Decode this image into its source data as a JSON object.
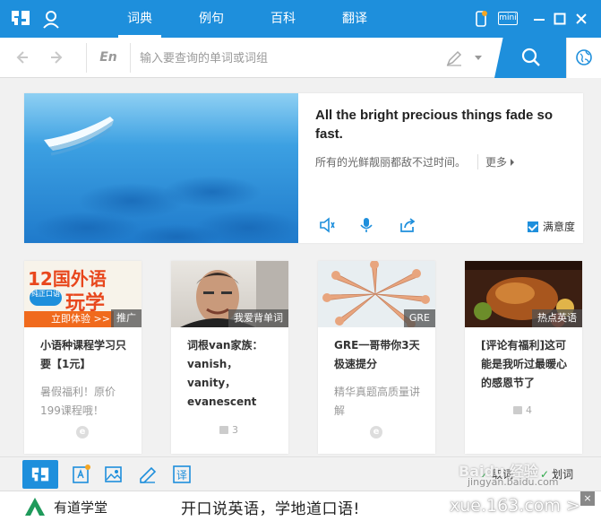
{
  "app": {
    "logo": "有",
    "tabs": [
      {
        "label": "词典",
        "active": true
      },
      {
        "label": "例句",
        "active": false
      },
      {
        "label": "百科",
        "active": false
      },
      {
        "label": "翻译",
        "active": false
      }
    ],
    "mini_label": "mini",
    "accent_color": "#1e8fdc"
  },
  "search": {
    "lang": "En",
    "placeholder": "输入要查询的单词或词组"
  },
  "hero": {
    "sentence": "All the bright precious things fade so fast.",
    "translation": "所有的光鲜靓丽都敌不过时间。",
    "more_label": "更多",
    "satisfaction_label": "满意度"
  },
  "cards": [
    {
      "tag": "推广",
      "title": "小语种课程学习只要【1元】",
      "desc": "暑假福利！原价199课程哦！",
      "image_text": [
        "12国外语",
        "纯正口语",
        "玩学",
        "立即体验 >>"
      ]
    },
    {
      "tag": "我爱背单词",
      "title": "词根van家族：vanish，vanity，evanescent",
      "likes": "3"
    },
    {
      "tag": "GRE",
      "title": "GRE一哥带你3天极速提分",
      "desc": "精华真题高质量讲解"
    },
    {
      "tag": "热点英语",
      "title": "[评论有福利]这可能是我听过最暖心的感恩节了",
      "likes": "4"
    }
  ],
  "bottom": {
    "logo": "有",
    "icons": [
      "word-card-icon",
      "image-translate-icon",
      "pen-write-icon",
      "translate-icon"
    ],
    "toggles": [
      {
        "label": "取词",
        "checked": true
      },
      {
        "label": "划词",
        "checked": true
      }
    ]
  },
  "ad": {
    "brand": "有道学堂",
    "slogan": "开口说英语，学地道口语!",
    "url": "xue.163.com >",
    "close": "×"
  },
  "watermark": {
    "text": "Baidu 经验",
    "sub": "jingyan.baidu.com"
  }
}
